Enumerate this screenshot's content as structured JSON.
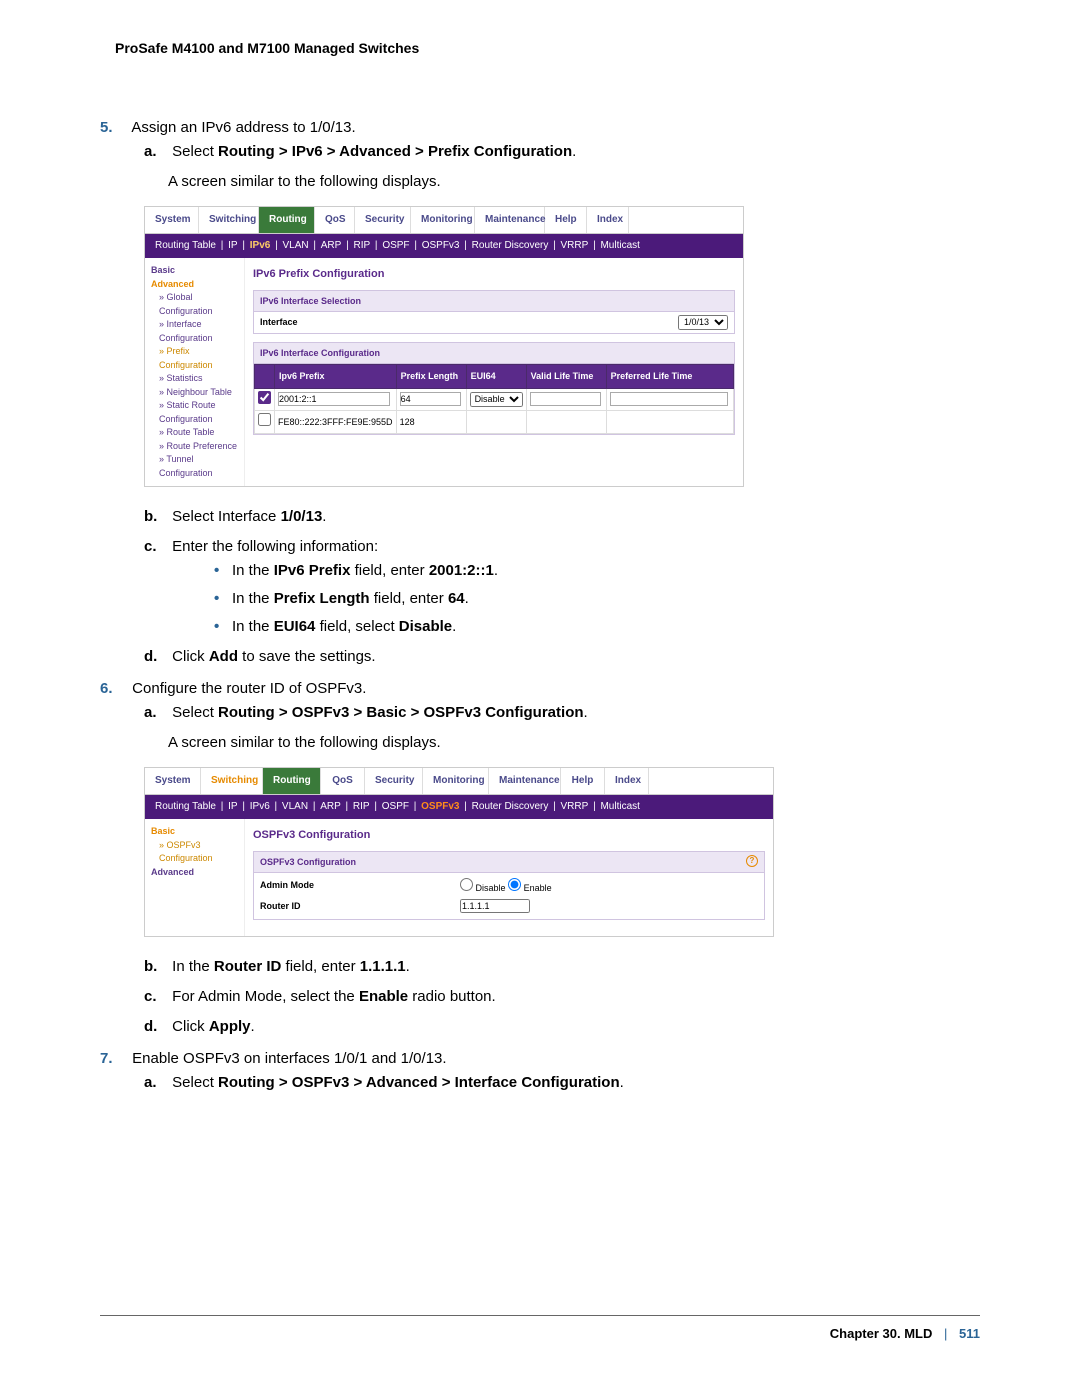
{
  "header": "ProSafe M4100 and M7100 Managed Switches",
  "step5": {
    "num": "5.",
    "text": "Assign an IPv6 address to 1/0/13.",
    "a_label": "a.",
    "a_pre": "Select ",
    "a_path": "Routing > IPv6 > Advanced > Prefix Configuration",
    "a_post": ".",
    "a_caption": "A screen similar to the following displays.",
    "b_label": "b.",
    "b_pre": "Select Interface ",
    "b_val": "1/0/13",
    "b_post": ".",
    "c_label": "c.",
    "c_text": "Enter the following information:",
    "bullets": [
      {
        "pre": "In the ",
        "bold1": "IPv6 Prefix",
        "mid": " field, enter ",
        "bold2": "2001:2::1",
        "post": "."
      },
      {
        "pre": "In the ",
        "bold1": "Prefix Length",
        "mid": " field, enter ",
        "bold2": "64",
        "post": "."
      },
      {
        "pre": "In the ",
        "bold1": "EUI64",
        "mid": " field, select ",
        "bold2": "Disable",
        "post": "."
      }
    ],
    "d_label": "d.",
    "d_pre": "Click ",
    "d_bold": "Add",
    "d_post": " to save the settings."
  },
  "step6": {
    "num": "6.",
    "text": "Configure the router ID of OSPFv3.",
    "a_label": "a.",
    "a_pre": "Select ",
    "a_path": "Routing > OSPFv3 > Basic > OSPFv3 Configuration",
    "a_post": ".",
    "a_caption": "A screen similar to the following displays.",
    "b_label": "b.",
    "b_pre": "In the ",
    "b_bold1": "Router ID",
    "b_mid": " field, enter ",
    "b_bold2": "1.1.1.1",
    "b_post": ".",
    "c_label": "c.",
    "c_pre": "For Admin Mode, select the ",
    "c_bold": "Enable",
    "c_post": " radio button.",
    "d_label": "d.",
    "d_pre": "Click ",
    "d_bold": "Apply",
    "d_post": "."
  },
  "step7": {
    "num": "7.",
    "text": "Enable OSPFv3 on interfaces 1/0/1 and 1/0/13.",
    "a_label": "a.",
    "a_pre": "Select ",
    "a_path": "Routing > OSPFv3 > Advanced > Interface Configuration",
    "a_post": "."
  },
  "ui1": {
    "topnav": [
      "System",
      "Switching",
      "Routing",
      "QoS",
      "Security",
      "Monitoring",
      "Maintenance",
      "Help",
      "Index"
    ],
    "subnav": [
      "Routing Table",
      "IP",
      "IPv6",
      "VLAN",
      "ARP",
      "RIP",
      "OSPF",
      "OSPFv3",
      "Router Discovery",
      "VRRP",
      "Multicast"
    ],
    "side": {
      "basic": "Basic",
      "advanced": "Advanced",
      "items": [
        "Global Configuration",
        "Interface Configuration",
        "Prefix Configuration",
        "Statistics",
        "Neighbour Table",
        "Static Route Configuration",
        "Route Table",
        "Route Preference",
        "Tunnel Configuration"
      ]
    },
    "title": "IPv6 Prefix Configuration",
    "fs1_title": "IPv6 Interface Selection",
    "fs1_label": "Interface",
    "fs1_value": "1/0/13",
    "fs2_title": "IPv6 Interface Configuration",
    "cols": [
      "",
      "Ipv6 Prefix",
      "Prefix Length",
      "EUI64",
      "Valid Life Time",
      "Preferred Life Time"
    ],
    "row1": {
      "prefix": "2001:2::1",
      "len": "64",
      "eui": "Disable"
    },
    "row2": {
      "prefix": "FE80::222:3FFF:FE9E:955D",
      "len": "128"
    }
  },
  "ui2": {
    "topnav": [
      "System",
      "Switching",
      "Routing",
      "QoS",
      "Security",
      "Monitoring",
      "Maintenance",
      "Help",
      "Index"
    ],
    "subnav": [
      "Routing Table",
      "IP",
      "IPv6",
      "VLAN",
      "ARP",
      "RIP",
      "OSPF",
      "OSPFv3",
      "Router Discovery",
      "VRRP",
      "Multicast"
    ],
    "side": {
      "basic": "Basic",
      "ospf": "OSPFv3 Configuration",
      "advanced": "Advanced"
    },
    "title": "OSPFv3 Configuration",
    "fs_title": "OSPFv3 Configuration",
    "admin_label": "Admin Mode",
    "disable": "Disable",
    "enable": "Enable",
    "router_label": "Router ID",
    "router_val": "1.1.1.1"
  },
  "footer": {
    "chapter": "Chapter 30.  MLD",
    "page": "511"
  }
}
